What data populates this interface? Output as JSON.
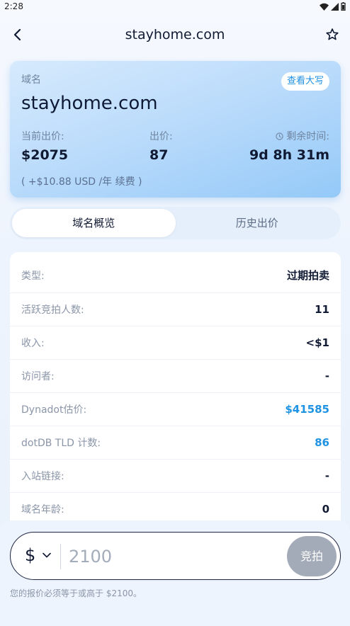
{
  "status_bar": {
    "time": "2:28"
  },
  "header": {
    "title": "stayhome.com"
  },
  "card": {
    "label": "域名",
    "view_upper_label": "查看大写",
    "domain": "stayhome.com",
    "current_price_label": "当前出价:",
    "current_price_value": "$2075",
    "bids_label": "出价:",
    "bids_value": "87",
    "time_left_label": "剩余时间:",
    "time_left_value": "9d 8h 31m",
    "renew_note": "( +$10.88 USD /年 续费 )"
  },
  "tabs": [
    {
      "label": "域名概览",
      "active": true
    },
    {
      "label": "历史出价",
      "active": false
    }
  ],
  "info_rows": [
    {
      "key": "类型:",
      "value": "过期拍卖"
    },
    {
      "key": "活跃竞拍人数:",
      "value": "11"
    },
    {
      "key": "收入:",
      "value": "<$1"
    },
    {
      "key": "访问者:",
      "value": "-"
    },
    {
      "key": "Dynadot估价:",
      "value": "$41585"
    },
    {
      "key": "dotDB TLD 计数:",
      "value": "86"
    },
    {
      "key": "入站链接:",
      "value": "-"
    },
    {
      "key": "域名年龄:",
      "value": "0"
    }
  ],
  "bid": {
    "currency": "$",
    "placeholder": "2100",
    "button_label": "竞拍",
    "note": "您的报价必须等于或高于 $2100。"
  },
  "colors": {
    "accent": "#1e93e3",
    "disabled_button": "#a3abb9"
  }
}
